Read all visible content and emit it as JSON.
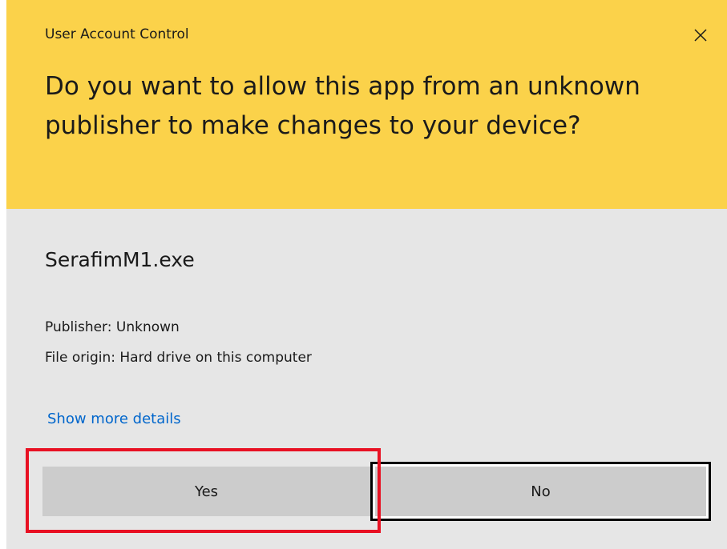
{
  "dialog": {
    "title": "User Account Control",
    "close_icon": "close-icon",
    "question": "Do you want to allow this app from an unknown publisher to make changes to your device?",
    "app_name": "SerafimM1.exe",
    "publisher": "Publisher: Unknown",
    "origin": "File origin: Hard drive on this computer",
    "details_link": "Show more details",
    "yes_label": "Yes",
    "no_label": "No"
  },
  "colors": {
    "header_bg": "#fbd24a",
    "body_bg": "#e6e6e6",
    "button_bg": "#cccccc",
    "link": "#0066cc",
    "highlight": "#e81123"
  }
}
